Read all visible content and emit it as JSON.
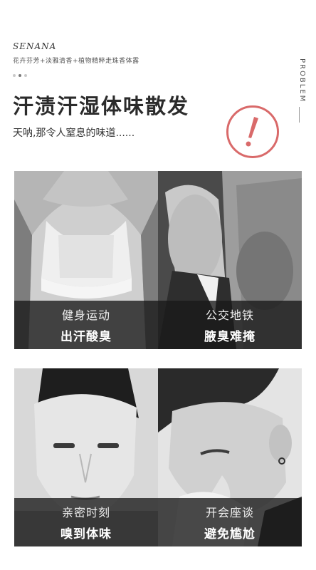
{
  "brand": {
    "logo": "SENANA",
    "tagline": "花卉芬芳+淡雅清香+植物精粹走珠香体露"
  },
  "side_label": "PROBLEM",
  "header": {
    "title": "汗渍汗湿体味散发",
    "subtitle": "天呐,那令人窒息的味道......"
  },
  "accent_color": "#d96a6a",
  "warning_icon": "exclamation-circle-icon",
  "cards": [
    {
      "scene": "健身运动",
      "pain": "出汗酸臭"
    },
    {
      "scene": "公交地铁",
      "pain": "腋臭难掩"
    },
    {
      "scene": "亲密时刻",
      "pain": "嗅到体味"
    },
    {
      "scene": "开会座谈",
      "pain": "避免尴尬"
    }
  ]
}
